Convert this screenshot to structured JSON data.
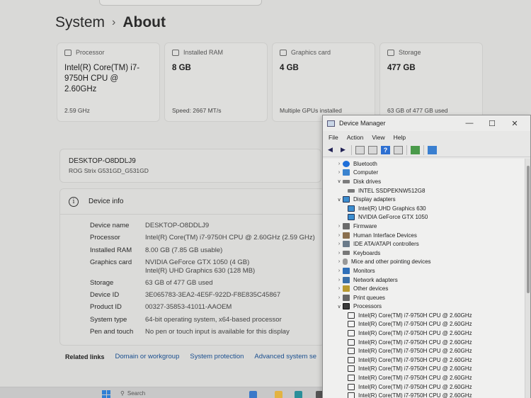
{
  "settings": {
    "breadcrumb": {
      "system": "System",
      "separator": "›",
      "current": "About"
    },
    "cards": [
      {
        "icon": "cpu-icon",
        "label": "Processor",
        "value": "Intel(R) Core(TM) i7-9750H CPU @ 2.60GHz",
        "sub": "2.59 GHz"
      },
      {
        "icon": "ram-icon",
        "label": "Installed RAM",
        "value": "8 GB",
        "sub": "Speed: 2667 MT/s"
      },
      {
        "icon": "gpu-icon",
        "label": "Graphics card",
        "value": "4 GB",
        "sub": "Multiple GPUs installed"
      },
      {
        "icon": "storage-icon",
        "label": "Storage",
        "value": "477 GB",
        "sub": "63 GB of 477 GB used"
      }
    ],
    "device": {
      "name": "DESKTOP-O8DDLJ9",
      "model": "ROG Strix G531GD_G531GD"
    },
    "device_info": {
      "title": "Device info",
      "rows": [
        {
          "label": "Device name",
          "value": "DESKTOP-O8DDLJ9"
        },
        {
          "label": "Processor",
          "value": "Intel(R) Core(TM) i7-9750H CPU @ 2.60GHz (2.59 GHz)"
        },
        {
          "label": "Installed RAM",
          "value": "8.00 GB (7.85 GB usable)"
        },
        {
          "label": "Graphics card",
          "value": "NVIDIA GeForce GTX 1050 (4 GB)",
          "value2": "Intel(R) UHD Graphics 630 (128 MB)"
        },
        {
          "label": "Storage",
          "value": "63 GB of 477 GB used"
        },
        {
          "label": "Device ID",
          "value": "3E065783-3EA2-4E5F-922D-F8E835C45867"
        },
        {
          "label": "Product ID",
          "value": "00327-35853-41011-AAOEM"
        },
        {
          "label": "System type",
          "value": "64-bit operating system, x64-based processor"
        },
        {
          "label": "Pen and touch",
          "value": "No pen or touch input is available for this display"
        }
      ]
    },
    "related": {
      "label": "Related links",
      "links": [
        "Domain or workgroup",
        "System protection",
        "Advanced system se"
      ]
    },
    "taskbar": {
      "search": "Search"
    }
  },
  "device_manager": {
    "title": "Device Manager",
    "menu": [
      "File",
      "Action",
      "View",
      "Help"
    ],
    "tree": [
      {
        "exp": ">",
        "icon": "bt",
        "label": "Bluetooth",
        "level": 0
      },
      {
        "exp": ">",
        "icon": "pc",
        "label": "Computer",
        "level": 0
      },
      {
        "exp": "v",
        "icon": "disk",
        "label": "Disk drives",
        "level": 0
      },
      {
        "exp": "",
        "icon": "disk",
        "label": "INTEL SSDPEKNW512G8",
        "level": 1
      },
      {
        "exp": "v",
        "icon": "disp",
        "label": "Display adapters",
        "level": 0
      },
      {
        "exp": "",
        "icon": "disp",
        "label": "Intel(R) UHD Graphics 630",
        "level": 1
      },
      {
        "exp": "",
        "icon": "disp",
        "label": "NVIDIA GeForce GTX 1050",
        "level": 1
      },
      {
        "exp": ">",
        "icon": "fw",
        "label": "Firmware",
        "level": 0
      },
      {
        "exp": ">",
        "icon": "hid",
        "label": "Human Interface Devices",
        "level": 0
      },
      {
        "exp": ">",
        "icon": "ide",
        "label": "IDE ATA/ATAPI controllers",
        "level": 0
      },
      {
        "exp": ">",
        "icon": "kb",
        "label": "Keyboards",
        "level": 0
      },
      {
        "exp": ">",
        "icon": "mouse",
        "label": "Mice and other pointing devices",
        "level": 0
      },
      {
        "exp": ">",
        "icon": "mon",
        "label": "Monitors",
        "level": 0
      },
      {
        "exp": ">",
        "icon": "net",
        "label": "Network adapters",
        "level": 0
      },
      {
        "exp": ">",
        "icon": "other",
        "label": "Other devices",
        "level": 0
      },
      {
        "exp": ">",
        "icon": "print",
        "label": "Print queues",
        "level": 0
      },
      {
        "exp": "v",
        "icon": "cpu",
        "label": "Processors",
        "level": 0
      },
      {
        "exp": "",
        "icon": "cpu-sm",
        "label": "Intel(R) Core(TM) i7-9750H CPU @ 2.60GHz",
        "level": 1
      },
      {
        "exp": "",
        "icon": "cpu-sm",
        "label": "Intel(R) Core(TM) i7-9750H CPU @ 2.60GHz",
        "level": 1
      },
      {
        "exp": "",
        "icon": "cpu-sm",
        "label": "Intel(R) Core(TM) i7-9750H CPU @ 2.60GHz",
        "level": 1
      },
      {
        "exp": "",
        "icon": "cpu-sm",
        "label": "Intel(R) Core(TM) i7-9750H CPU @ 2.60GHz",
        "level": 1
      },
      {
        "exp": "",
        "icon": "cpu-sm",
        "label": "Intel(R) Core(TM) i7-9750H CPU @ 2.60GHz",
        "level": 1
      },
      {
        "exp": "",
        "icon": "cpu-sm",
        "label": "Intel(R) Core(TM) i7-9750H CPU @ 2.60GHz",
        "level": 1
      },
      {
        "exp": "",
        "icon": "cpu-sm",
        "label": "Intel(R) Core(TM) i7-9750H CPU @ 2.60GHz",
        "level": 1
      },
      {
        "exp": "",
        "icon": "cpu-sm",
        "label": "Intel(R) Core(TM) i7-9750H CPU @ 2.60GHz",
        "level": 1
      },
      {
        "exp": "",
        "icon": "cpu-sm",
        "label": "Intel(R) Core(TM) i7-9750H CPU @ 2.60GHz",
        "level": 1
      },
      {
        "exp": "",
        "icon": "cpu-sm",
        "label": "Intel(R) Core(TM) i7-9750H CPU @ 2.60GHz",
        "level": 1
      }
    ]
  }
}
